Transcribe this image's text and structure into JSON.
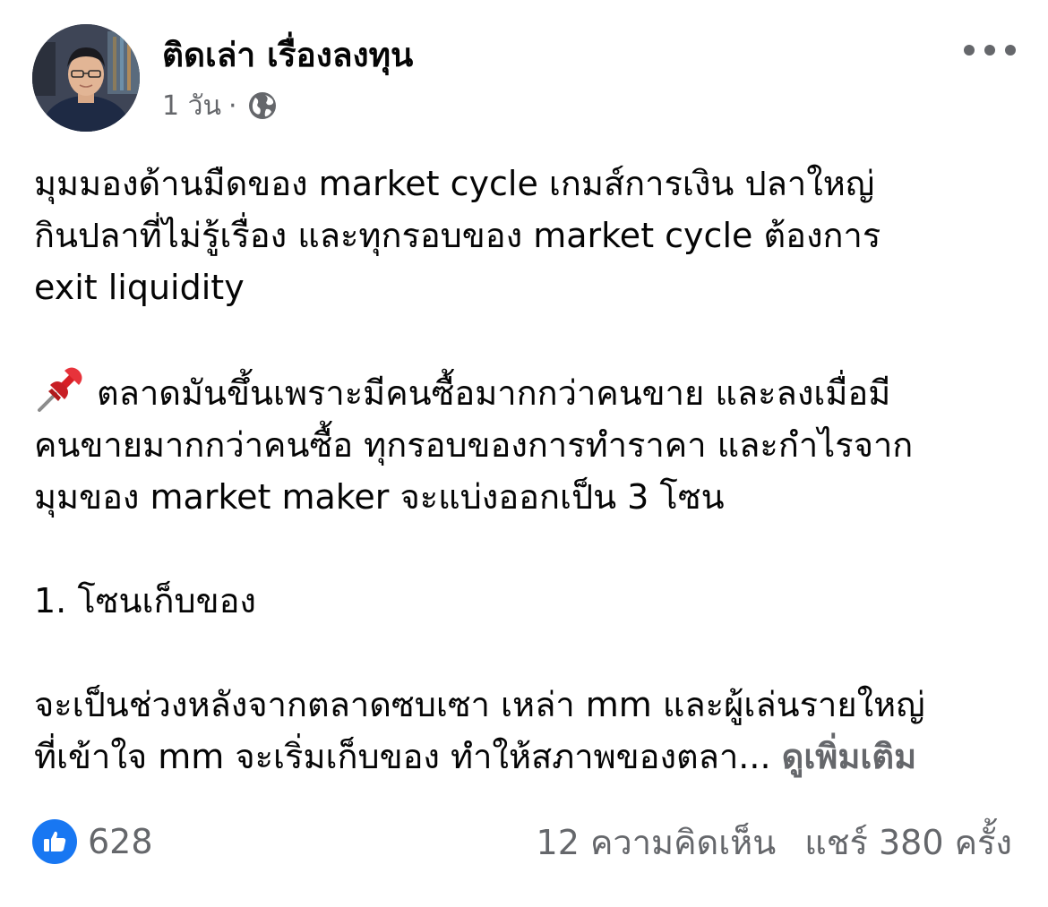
{
  "post": {
    "author": "ติดเล่า เรื่องลงทุน",
    "time": "1 วัน",
    "separator": "·",
    "privacy_icon": "globe-icon",
    "paragraphs": {
      "p1": "มุมมองด้านมืดของ market cycle เกมส์การเงิน ปลาใหญ่\nกินปลาที่ไม่รู้เรื่อง และทุกรอบของ market cycle ต้องการ\nexit liquidity",
      "p2": "ตลาดมันขึ้นเพราะมีคนซื้อมากกว่าคนขาย และลงเมื่อมี\nคนขายมากกว่าคนซื้อ ทุกรอบของการทำราคา และกำไรจาก\nมุมของ market maker จะแบ่งออกเป็น 3 โซน",
      "p3": "1. โซนเก็บของ",
      "p4": "จะเป็นช่วงหลังจากตลาดซบเซา เหล่า mm และผู้เล่นรายใหญ่\nที่เข้าใจ mm จะเริ่มเก็บของ ทำให้สภาพของตลา... "
    },
    "pin_icon": "pushpin-icon",
    "see_more": "ดูเพิ่มเติม"
  },
  "footer": {
    "like_count": "628",
    "comments": "12 ความคิดเห็น",
    "shares": "แชร์ 380 ครั้ง"
  },
  "colors": {
    "text": "#050505",
    "secondary": "#65676b",
    "like_blue": "#1877f2"
  }
}
